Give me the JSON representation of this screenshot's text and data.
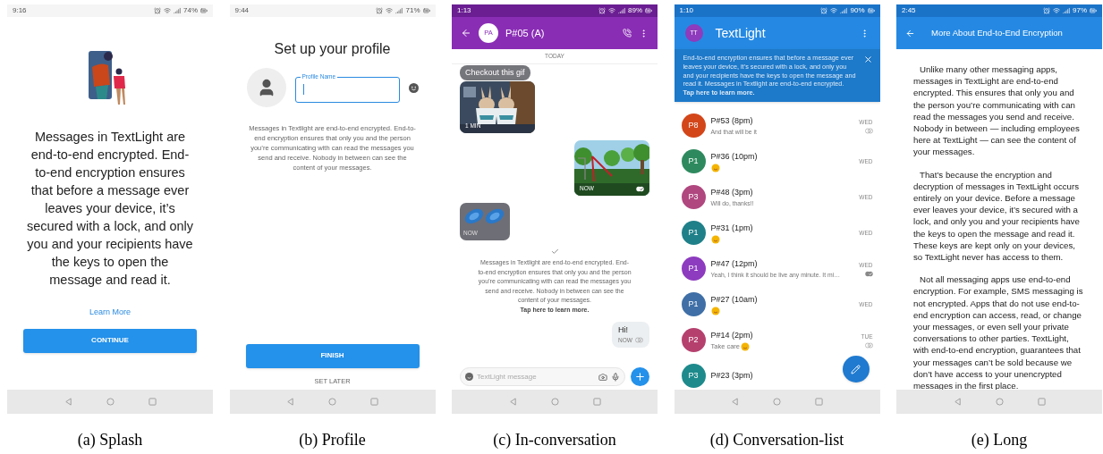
{
  "panels": [
    {
      "kind": "splash",
      "caption": "(a) Splash",
      "status_bar": {
        "time": "9:16",
        "battery": "74%"
      },
      "message": "Messages in TextLight are end-to-end encrypted. End-to-end encryption ensures that before a message ever leaves your device, it’s secured with a lock, and only you and your recipients have the keys to open the message and read it.",
      "link": "Learn More",
      "button": "CONTINUE"
    },
    {
      "kind": "profile",
      "caption": "(b) Profile",
      "status_bar": {
        "time": "9:44",
        "battery": "71%"
      },
      "title": "Set up your profile",
      "field": {
        "label": "Profile Name"
      },
      "info": "Messages in Textlight are end-to-end encrypted. End-to-end encryption ensures that only you and the person you’re communicating with can read the messages you send and receive. Nobody in between can see the content of your messages.",
      "button": "FINISH",
      "secondary_button": "SET LATER"
    },
    {
      "kind": "conversation",
      "caption": "(c) In-conversation",
      "status_bar": {
        "time": "1:13",
        "battery": "89%"
      },
      "avatar": "PA",
      "title": "P#05 (A)",
      "date": "TODAY",
      "messages": [
        {
          "kind": "text_image",
          "text": "Checkout this gif",
          "time": "1 MIN"
        },
        {
          "time": "NOW",
          "receipt": {
            "read": true
          }
        },
        {
          "kind": "sticker",
          "time": "NOW"
        },
        {
          "kind": "notice",
          "text": "Messages in Textlight are end-to-end encrypted. End-to-end encryption ensures that only you and the person you’re communicating with can read the messages you send and receive. Nobody in between can see the content of your messages.",
          "link": "Tap here to learn more."
        },
        {
          "kind": "text",
          "text": "Hi!",
          "time": "NOW",
          "receipt": {
            "read": false
          }
        }
      ],
      "composer": {
        "placeholder": "TextLight message"
      }
    },
    {
      "kind": "list",
      "caption": "(d) Conversation-list",
      "status_bar": {
        "time": "1:10",
        "battery": "90%"
      },
      "avatar": "TT",
      "title": "TextLight",
      "banner": "End-to-end encryption ensures that before a message ever leaves your device, it’s secured with a lock, and only you and your recipients have the keys to open the message and read it. Messages in Textlight are end-to-end encrypted. **Tap here to learn more.**",
      "rows": [
        {
          "initials": "P8",
          "color": "#d3461a",
          "name": "P#53 (8pm)",
          "kind": "text",
          "preview": "And that will be it",
          "time": "WED",
          "receipt": {
            "read": false
          }
        },
        {
          "initials": "P1",
          "color": "#2e8a5e",
          "name": "P#36 (10pm)",
          "kind": "emoji",
          "time": "WED"
        },
        {
          "initials": "P3",
          "color": "#b0477f",
          "name": "P#48 (3pm)",
          "kind": "text",
          "preview": "Will do, thanks!!",
          "time": "WED"
        },
        {
          "initials": "P1",
          "color": "#1f8089",
          "name": "P#31 (1pm)",
          "kind": "emoji",
          "time": "WED"
        },
        {
          "initials": "P1",
          "color": "#8d3bbf",
          "name": "P#47 (12pm)",
          "kind": "text",
          "preview": "Yeah, I think it should be live any minute. It mi…",
          "time": "WED",
          "receipt": {
            "read": true
          }
        },
        {
          "initials": "P1",
          "color": "#3f6fa6",
          "name": "P#27 (10am)",
          "kind": "emoji",
          "time": "WED"
        },
        {
          "initials": "P2",
          "color": "#b5406e",
          "name": "P#14 (2pm)",
          "kind": "text_emoji",
          "preview": "Take care",
          "time": "TUE",
          "receipt": {
            "read": false
          }
        },
        {
          "initials": "P3",
          "color": "#1e8a8c",
          "name": "P#23 (3pm)",
          "kind": "none"
        }
      ]
    },
    {
      "kind": "long",
      "caption": "(e) Long",
      "status_bar": {
        "time": "2:45",
        "battery": "97%"
      },
      "title": "More About End-to-End Encryption",
      "paragraphs": [
        "Unlike many other messaging apps, messages in TextLight are end-to-end encrypted. This ensures that only you and the person you’re communicating with can read the messages you send and receive. Nobody in between — including employees here at TextLight — can see the content of your messages.",
        "That’s because the encryption and decryption of messages in TextLight occurs entirely on your device. Before a message ever leaves your device, it’s secured with a lock, and only you and your recipients have the keys to open the message and read it. These keys are kept only on your devices, so TextLight never has access to them.",
        "Not all messaging apps use end-to-end encryption. For example, SMS messaging is not encrypted. Apps that do not use end-to-end encryption can access, read, or change your messages, or even sell your private conversations to other parties. TextLight, with end-to-end encryption, guarantees that your messages can’t be sold because we don’t have access to your unencrypted messages in the first place."
      ]
    }
  ]
}
